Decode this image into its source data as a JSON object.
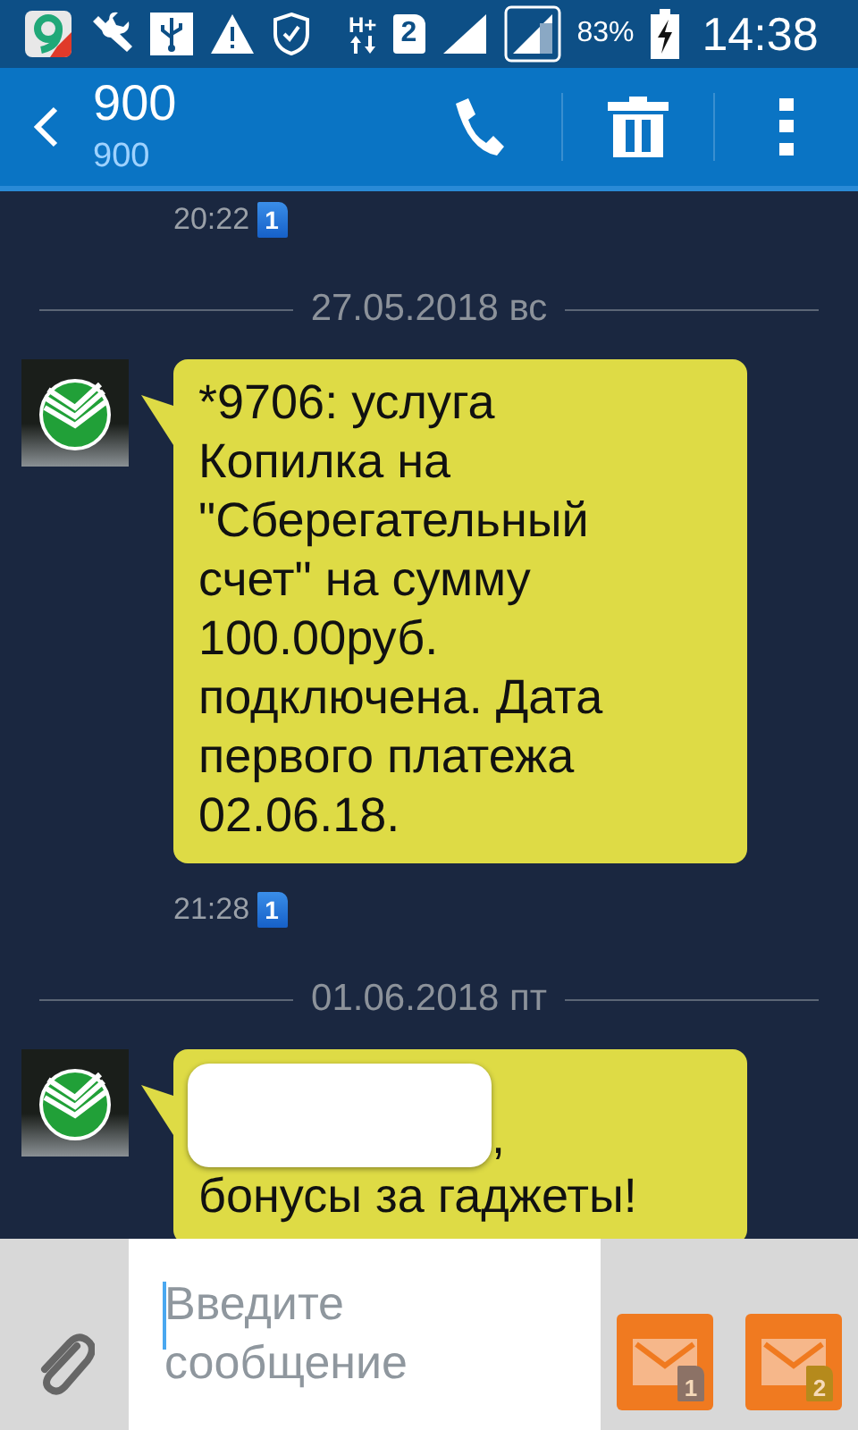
{
  "status_bar": {
    "network": "H+",
    "sim_slot": "2",
    "battery": "83%",
    "time": "14:38"
  },
  "header": {
    "title": "900",
    "subtitle": "900"
  },
  "messages": [
    {
      "kind": "meta",
      "time": "20:22",
      "sim": "1"
    },
    {
      "kind": "date",
      "text": "27.05.2018 вс"
    },
    {
      "kind": "incoming",
      "text": "*9706: услуга Копилка на \"Сберегательный счет\" на сумму 100.00руб. подключена. Дата первого платежа 02.06.18.",
      "redacted": false
    },
    {
      "kind": "meta",
      "time": "21:28",
      "sim": "1"
    },
    {
      "kind": "date",
      "text": "01.06.2018 пт"
    },
    {
      "kind": "incoming",
      "text": ", бонусы за гаджеты!",
      "redacted": true
    }
  ],
  "composer": {
    "placeholder": "Введите сообщение",
    "send_buttons": [
      {
        "sim": "1",
        "color": "#8c7266"
      },
      {
        "sim": "2",
        "color": "#b58a1c"
      }
    ]
  }
}
